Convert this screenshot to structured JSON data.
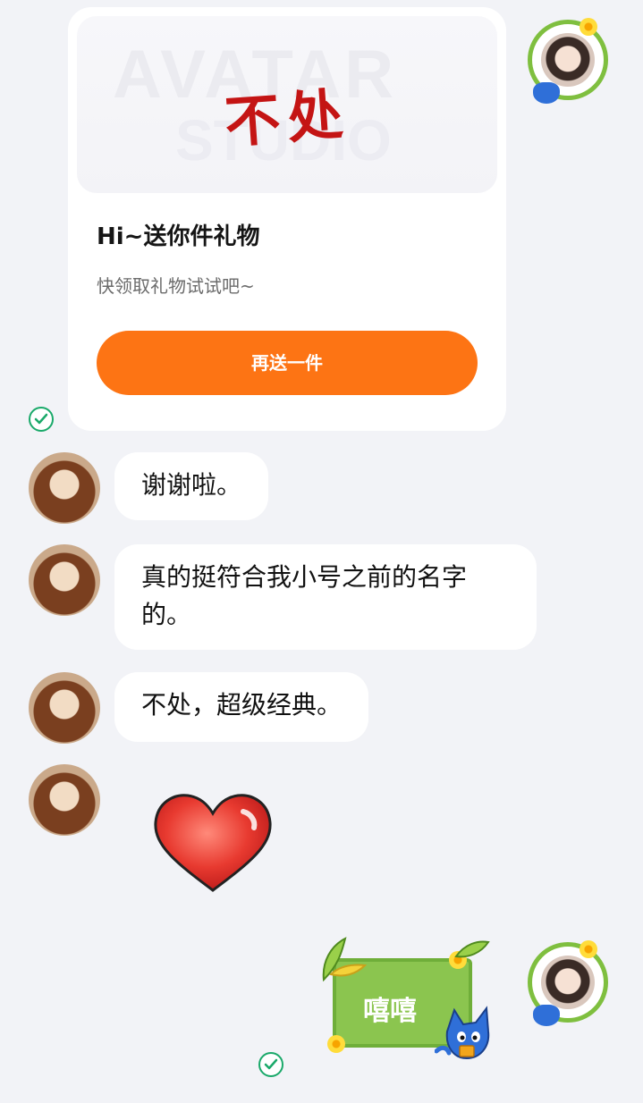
{
  "gift_card": {
    "gift_name": "不处",
    "watermark_line1": "AVATAR",
    "watermark_line2": "STUDIO",
    "title": "Hi~送你件礼物",
    "subtitle": "快领取礼物试试吧~",
    "button_label": "再送一件"
  },
  "messages": [
    {
      "sender": "other",
      "text": "谢谢啦。"
    },
    {
      "sender": "other",
      "text_line1": "真的挺符合我小号之前的名字",
      "text_line2": "的。"
    },
    {
      "sender": "other",
      "text": "不处，超级经典。"
    },
    {
      "sender": "other",
      "type": "emoji",
      "emoji": "heart"
    },
    {
      "sender": "self",
      "type": "sticker",
      "text": "嘻嘻"
    }
  ],
  "colors": {
    "background": "#f2f3f7",
    "accent_orange": "#fd7414",
    "read_tick_green": "#1aa96a",
    "sticker_green": "#8bc54f"
  },
  "icons": [
    "read-check-icon",
    "heart-emoji-icon",
    "avatar-frame-icon"
  ]
}
